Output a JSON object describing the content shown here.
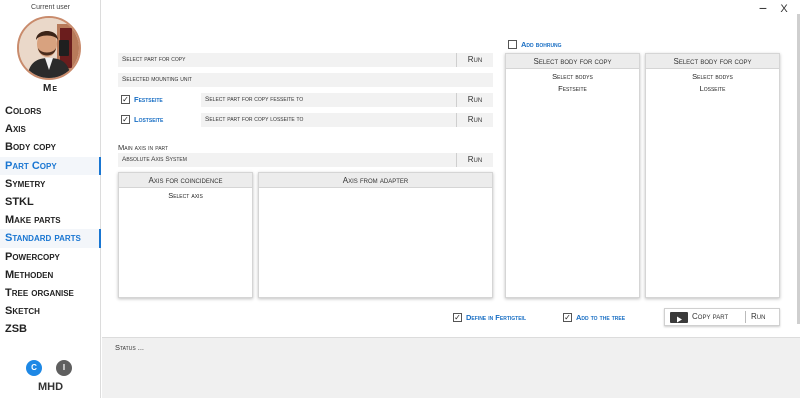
{
  "sidebar": {
    "current_user_label": "Current user",
    "user_name": "Me",
    "items": [
      {
        "label": "Colors"
      },
      {
        "label": "Axis"
      },
      {
        "label": "Body copy"
      },
      {
        "label": "Part Copy"
      },
      {
        "label": "Symetry"
      },
      {
        "label": "STKL"
      },
      {
        "label": "Make parts"
      },
      {
        "label": "Standard parts"
      },
      {
        "label": "Powercopy"
      },
      {
        "label": "Methoden"
      },
      {
        "label": "Tree organise"
      },
      {
        "label": "Sketch"
      },
      {
        "label": "ZSB"
      }
    ],
    "active_items": [
      "Part Copy",
      "Standard parts"
    ],
    "button_c": "C",
    "button_i": "I",
    "brand": "MHD"
  },
  "window": {
    "minimize": "−",
    "close": "X"
  },
  "form": {
    "select_part_label": "Select part for copy",
    "select_part_run": "Run",
    "mounting_unit_label": "Selected mounting unit",
    "festseite_checked": true,
    "festseite_label": "Festseite",
    "festseite_field": "Select part for copy fesseite to",
    "festseite_run": "Run",
    "losseite_checked": true,
    "losseite_label": "Lostseite",
    "losseite_field": "Select part for copy losseite to",
    "losseite_run": "Run",
    "main_axis_label": "Main axis in part",
    "axis_system_label": "Absolute Axis System",
    "axis_system_run": "Run"
  },
  "panels": {
    "coincidence_header": "Axis for coincidence",
    "coincidence_line": "Select axis",
    "adapter_header": "Axis from adapter"
  },
  "bohrung": {
    "checked": false,
    "label": "Add bohrung"
  },
  "body_panels": [
    {
      "header": "Select body for copy",
      "line1": "Select bodys",
      "line2": "Festseite"
    },
    {
      "header": "Select body for copy",
      "line1": "Select bodys",
      "line2": "Losseite"
    }
  ],
  "options": {
    "define_checked": true,
    "define_label": "Define in Fertigteil",
    "tree_checked": true,
    "tree_label": "Add to the tree"
  },
  "actions": {
    "copy_part": "Copy part",
    "run": "Run"
  },
  "status": {
    "text": "Status ..."
  },
  "colors": {
    "accent": "#1976d2",
    "button_c": "#1e88e5",
    "button_i": "#5f5f5f"
  }
}
